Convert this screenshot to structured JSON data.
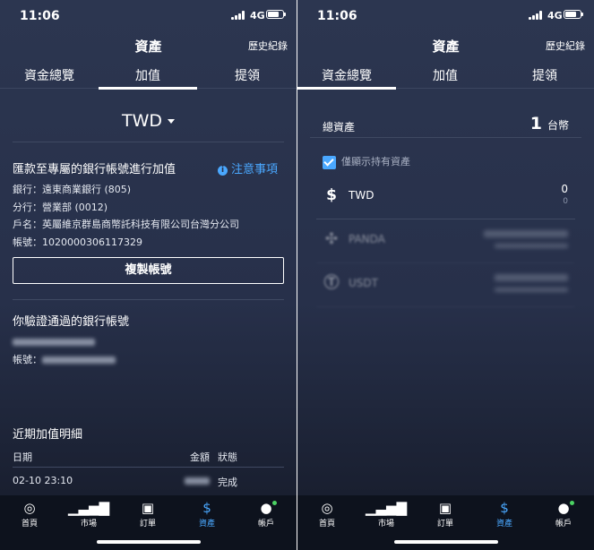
{
  "status_bar": {
    "time": "11:06",
    "network": "4G"
  },
  "header": {
    "title": "資產",
    "history_link": "歷史紀錄"
  },
  "tabs": [
    {
      "label": "資金總覽"
    },
    {
      "label": "加值"
    },
    {
      "label": "提領"
    }
  ],
  "deposit": {
    "currency": "TWD",
    "section_title": "匯款至專屬的銀行帳號進行加值",
    "notice_label": "注意事項",
    "bank_line": "銀行：遠東商業銀行 (805)",
    "branch_line": "分行：營業部 (0012)",
    "holder_line": "戶名：英屬維京群島商幣託科技有限公司台灣分公司",
    "account_line": "帳號：1020000306117329",
    "copy_button": "複製帳號",
    "verified_title": "你驗證通過的銀行帳號",
    "verified_account_label": "帳號：",
    "history_title": "近期加值明細",
    "table_headers": {
      "date": "日期",
      "amount": "金額",
      "status": "狀態"
    },
    "rows": [
      {
        "date": "02-10 23:10",
        "status": "完成"
      }
    ]
  },
  "overview": {
    "total_label": "總資產",
    "total_value": "1",
    "total_unit": "台幣",
    "filter_label": "僅顯示持有資產",
    "filter_checked": true,
    "assets": [
      {
        "icon": "dollar-icon",
        "name": "TWD",
        "balance": "0",
        "value": "0"
      },
      {
        "icon": "panda-icon",
        "name": "PANDA",
        "faded": true
      },
      {
        "icon": "usdt-icon",
        "name": "USDT",
        "faded": true
      }
    ]
  },
  "tabbar": {
    "items": [
      {
        "icon": "home-icon",
        "label": "首頁"
      },
      {
        "icon": "market-icon",
        "label": "市場"
      },
      {
        "icon": "orders-icon",
        "label": "訂單"
      },
      {
        "icon": "assets-icon",
        "label": "資產"
      },
      {
        "icon": "account-icon",
        "label": "帳戶"
      }
    ],
    "active_index": 3
  },
  "colors": {
    "background": "#27304a",
    "accent": "#4aa8ff",
    "tabbar": "#0d121d",
    "online_dot": "#4bd263"
  }
}
